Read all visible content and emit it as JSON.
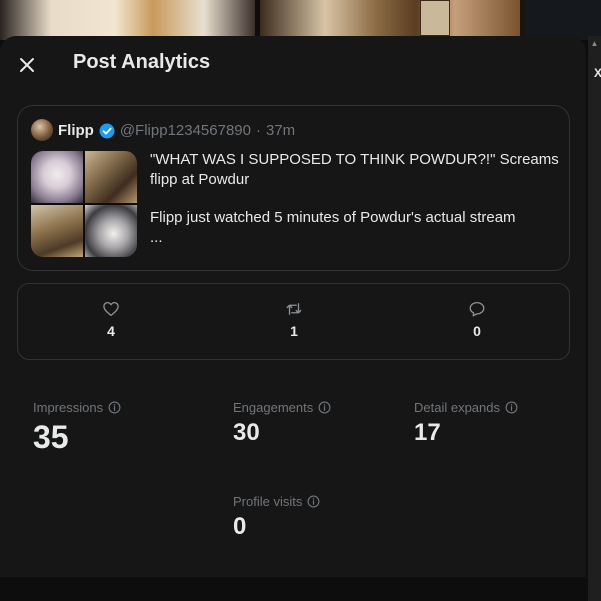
{
  "modal": {
    "title": "Post Analytics"
  },
  "post": {
    "author_name": "Flipp",
    "handle": "@Flipp1234567890",
    "separator": "·",
    "time": "37m",
    "text_line1": "\"WHAT WAS I SUPPOSED TO THINK POWDUR?!\" Screams flipp at Powdur",
    "text_line2": "Flipp just watched 5 minutes of Powdur's actual stream",
    "text_more": "..."
  },
  "engagement": {
    "likes": "4",
    "reposts": "1",
    "replies": "0"
  },
  "metrics": {
    "impressions": {
      "label": "Impressions",
      "value": "35"
    },
    "engagements": {
      "label": "Engagements",
      "value": "30"
    },
    "detail_expands": {
      "label": "Detail expands",
      "value": "17"
    },
    "profile_visits": {
      "label": "Profile visits",
      "value": "0"
    }
  },
  "colors": {
    "background": "#161616",
    "text": "#e7e9ea",
    "muted": "#71767b",
    "border": "#2f3336",
    "verified": "#1d9bf0"
  },
  "icons": [
    "close-icon",
    "verified-badge-icon",
    "heart-icon",
    "repost-icon",
    "reply-icon",
    "info-icon"
  ]
}
